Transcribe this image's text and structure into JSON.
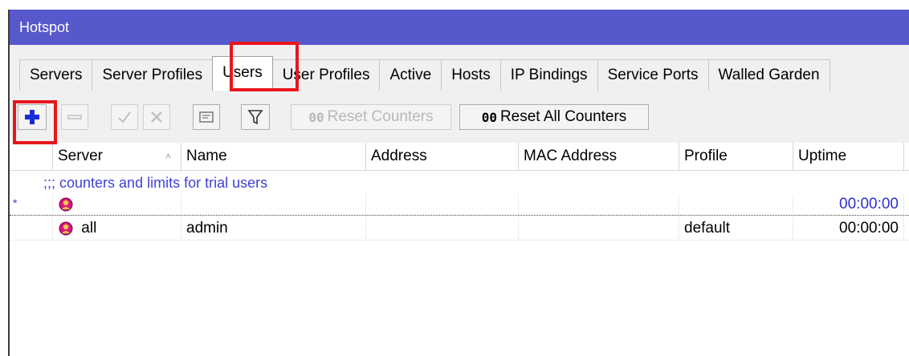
{
  "window": {
    "title": "Hotspot"
  },
  "tabs": [
    {
      "label": "Servers"
    },
    {
      "label": "Server Profiles"
    },
    {
      "label": "Users"
    },
    {
      "label": "User Profiles"
    },
    {
      "label": "Active"
    },
    {
      "label": "Hosts"
    },
    {
      "label": "IP Bindings"
    },
    {
      "label": "Service Ports"
    },
    {
      "label": "Walled Garden"
    }
  ],
  "toolbar": {
    "reset_counters_label": "Reset Counters",
    "reset_all_counters_label": "Reset All Counters",
    "counter_glyph": "00"
  },
  "table": {
    "columns": [
      "Server",
      "Name",
      "Address",
      "MAC Address",
      "Profile",
      "Uptime"
    ],
    "comment": ";;; counters and limits for trial users",
    "rows": [
      {
        "flag": "*",
        "server": "",
        "name": "",
        "address": "",
        "mac": "",
        "profile": "",
        "uptime": "00:00:00"
      },
      {
        "flag": "",
        "server": "all",
        "name": "admin",
        "address": "",
        "mac": "",
        "profile": "default",
        "uptime": "00:00:00"
      }
    ]
  },
  "colors": {
    "titlebar": "#5758cc",
    "highlight": "#e8161b",
    "add_icon": "#1a2ad8",
    "comment_text": "#4040d8"
  }
}
